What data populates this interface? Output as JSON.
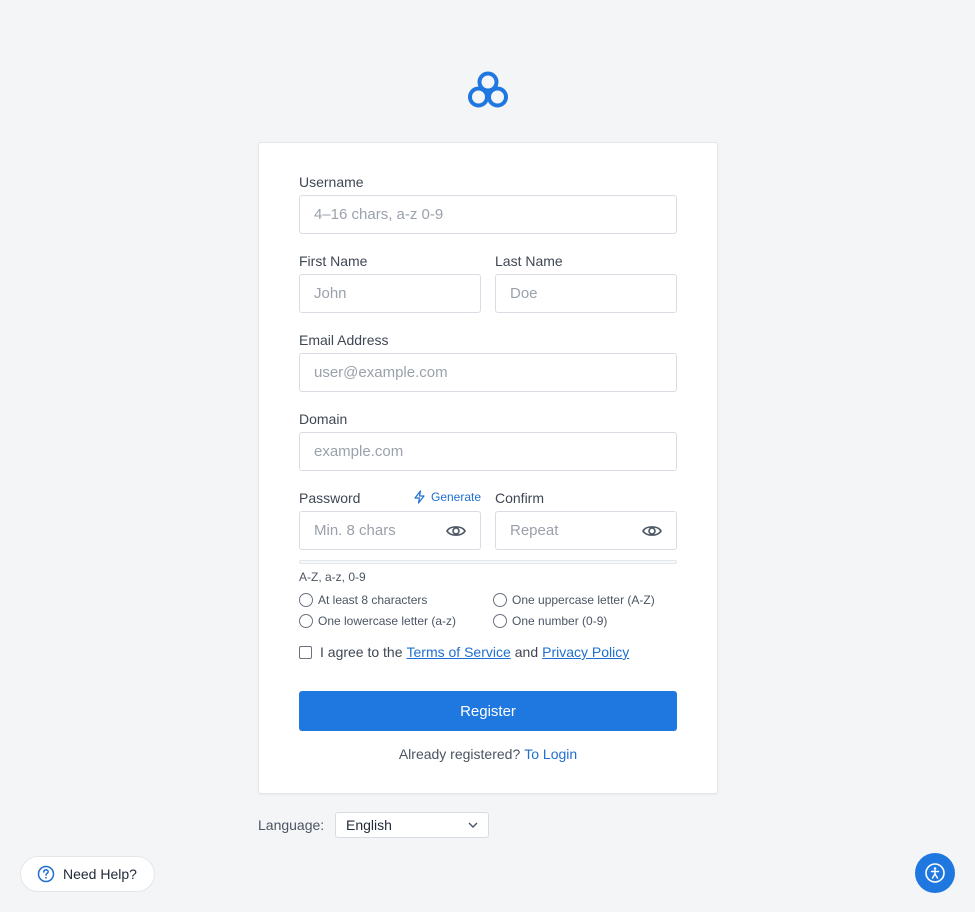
{
  "form": {
    "username": {
      "label": "Username",
      "placeholder": "4–16 chars, a-z 0-9"
    },
    "first_name": {
      "label": "First Name",
      "placeholder": "John"
    },
    "last_name": {
      "label": "Last Name",
      "placeholder": "Doe"
    },
    "email": {
      "label": "Email Address",
      "placeholder": "user@example.com"
    },
    "domain": {
      "label": "Domain",
      "placeholder": "example.com"
    },
    "password": {
      "label": "Password",
      "placeholder": "Min. 8 chars",
      "generate_label": "Generate"
    },
    "confirm": {
      "label": "Confirm",
      "placeholder": "Repeat"
    },
    "charset_hint": "A-Z, a-z, 0-9",
    "requirements": [
      "At least 8 characters",
      "One uppercase letter (A-Z)",
      "One lowercase letter (a-z)",
      "One number (0-9)"
    ],
    "agree": {
      "prefix": "I agree to the",
      "terms_link": "Terms of Service",
      "and": "and",
      "privacy_link": "Privacy Policy"
    },
    "register_label": "Register",
    "login_prompt": "Already registered?",
    "login_link": "To Login"
  },
  "language": {
    "label": "Language:",
    "selected": "English"
  },
  "help": {
    "label": "Need Help?"
  },
  "colors": {
    "accent": "#1f78e0",
    "link": "#1f6fd0",
    "background": "#f4f5f7"
  },
  "icons": {
    "logo": "three-circles-logo-icon",
    "eye": "eye-icon",
    "generate": "lightning-bolt-icon",
    "help": "question-circle-icon",
    "accessibility": "accessibility-icon"
  }
}
